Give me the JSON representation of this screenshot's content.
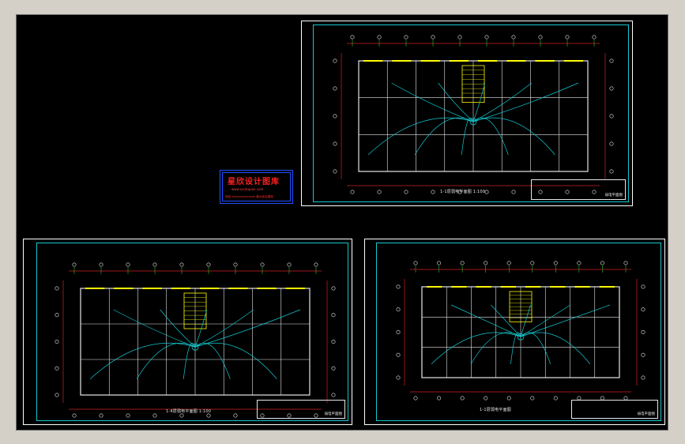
{
  "canvas": {
    "background": "#000000"
  },
  "colors": {
    "frame": "#ffffff",
    "inner_frame": "#12c8d0",
    "wall": "#e6e6e6",
    "wiring": "#12c8d0",
    "dimension": "#d02020",
    "axis": "#30e030",
    "highlight": "#ffff00",
    "stamp_border": "#2050ff",
    "stamp_text": "#ff2020"
  },
  "stamp": {
    "title": "星欣设计图库",
    "url": "www.xxxtupian.com",
    "line": "网站 xxxxxxxxxxxxxx 最大综合图库"
  },
  "sheets": [
    {
      "id": "top-right",
      "title": "1-1层弱电平面图  1:100",
      "title_block": "弱电平面图"
    },
    {
      "id": "bottom-left",
      "title": "1-4层弱电平面图  1:100",
      "title_block": "弱电平面图"
    },
    {
      "id": "bottom-right",
      "title": "1-1层弱电平面图",
      "title_block": "弱电平面图"
    }
  ]
}
